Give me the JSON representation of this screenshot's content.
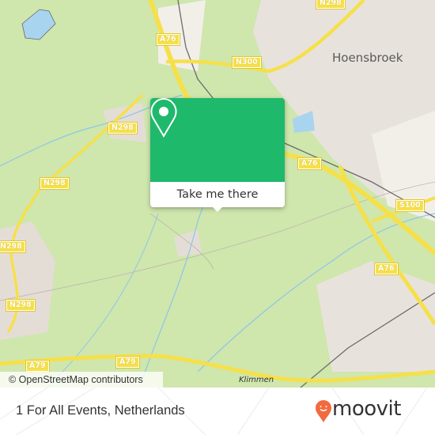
{
  "map": {
    "road_shields": [
      {
        "label": "N298",
        "id": "n298-top"
      },
      {
        "label": "A76",
        "id": "a76-north"
      },
      {
        "label": "N300",
        "id": "n300"
      },
      {
        "label": "N298",
        "id": "n298-1"
      },
      {
        "label": "N298",
        "id": "n298-2"
      },
      {
        "label": "N298",
        "id": "n298-3"
      },
      {
        "label": "N298",
        "id": "n298-4"
      },
      {
        "label": "A76",
        "id": "a76-mid"
      },
      {
        "label": "S100",
        "id": "s100"
      },
      {
        "label": "A76",
        "id": "a76-south"
      },
      {
        "label": "A79",
        "id": "a79-west"
      },
      {
        "label": "A79",
        "id": "a79-mid"
      }
    ],
    "places": {
      "town": "Hoensbroek",
      "village": "Klimmen"
    },
    "attribution": "© OpenStreetMap contributors",
    "colors": {
      "land": "#cfe6ad",
      "urban": "#e8e2dd",
      "water": "#a8d4ef",
      "motorway": "#f6e04a",
      "popup_accent": "#1fb96c"
    }
  },
  "popup": {
    "cta_label": "Take me there",
    "icon": "location-pin-icon"
  },
  "footer": {
    "title": "1 For All Events, Netherlands",
    "brand": "moovit",
    "brand_color": "#f36a3f"
  }
}
